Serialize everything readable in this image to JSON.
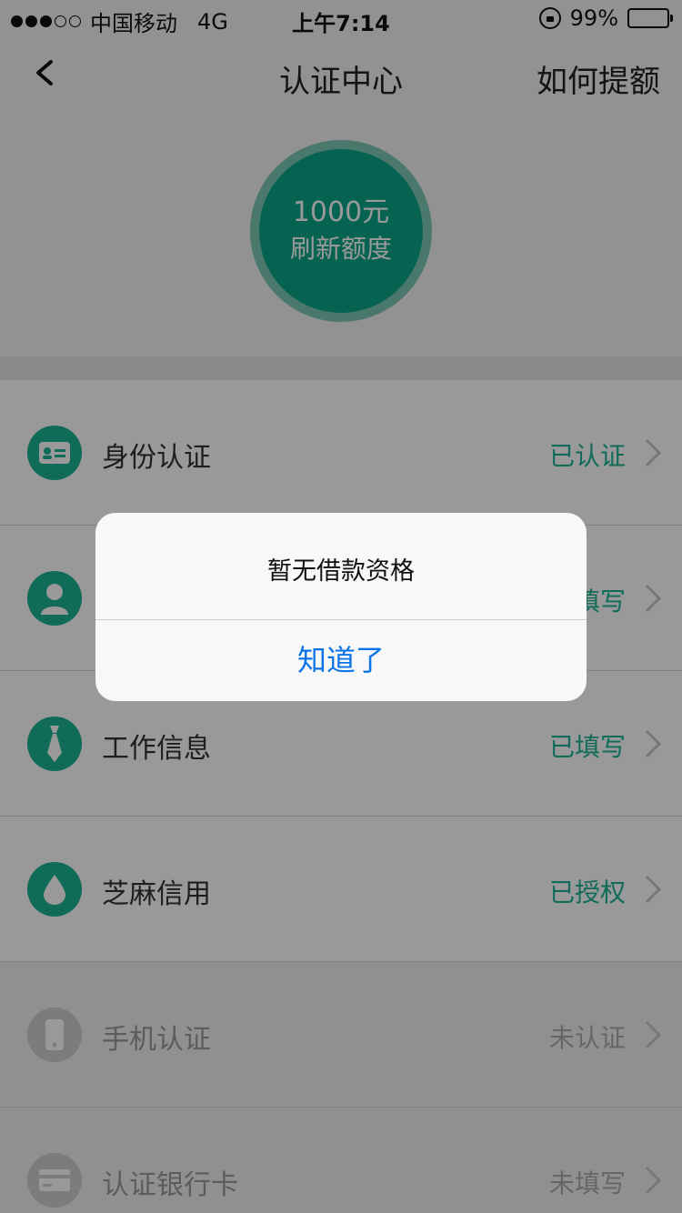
{
  "status_bar": {
    "carrier": "中国移动",
    "network": "4G",
    "time": "上午7:14",
    "battery": "99%"
  },
  "nav": {
    "title": "认证中心",
    "right_action": "如何提额"
  },
  "credit": {
    "amount": "1000元",
    "action": "刷新额度"
  },
  "list": {
    "items": [
      {
        "label": "身份认证",
        "status": "已认证",
        "icon": "id-card-icon"
      },
      {
        "label": "",
        "status": "填写",
        "icon": "person-icon"
      },
      {
        "label": "工作信息",
        "status": "已填写",
        "icon": "necktie-icon"
      },
      {
        "label": "芝麻信用",
        "status": "已授权",
        "icon": "drop-icon"
      },
      {
        "label": "手机认证",
        "status": "未认证",
        "icon": "phone-icon"
      },
      {
        "label": "认证银行卡",
        "status": "未填写",
        "icon": "bank-card-icon"
      }
    ]
  },
  "dialog": {
    "message": "暂无借款资格",
    "button": "知道了"
  },
  "colors": {
    "accent": "#1cb394",
    "link_blue": "#0a73e6"
  }
}
